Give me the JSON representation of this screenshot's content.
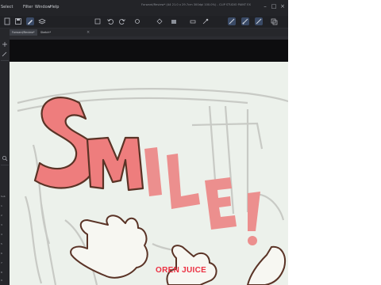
{
  "app": {
    "title": "Forward/Review* (A4 21.0 x 29.7cm 300dpi 100.0%) - CLIP STUDIO PAINT EX",
    "accent_color": "#3a4a66"
  },
  "menubar": {
    "items": [
      "Select",
      "Filter",
      "Window",
      "Help"
    ],
    "window_controls": [
      "minimize-icon",
      "maximize-icon",
      "close-icon"
    ]
  },
  "toolbar": {
    "icons": [
      "new-file-icon",
      "save-icon",
      "undo-icon",
      "redo-icon",
      "transform-icon",
      "fill-icon",
      "select-icon",
      "pen-icon",
      "eraser-icon",
      "brush-icon",
      "layer-icon",
      "settings-icon",
      "ruler-icon",
      "snap-icon",
      "grid-icon"
    ]
  },
  "tabs": {
    "items": [
      "Forward/Review*",
      "Sketch*"
    ]
  },
  "toolstrip": {
    "labels": [
      "Sub",
      "1",
      "2",
      "3",
      "4",
      "5",
      "6",
      "7",
      "8",
      "9"
    ],
    "icons": [
      "search-icon",
      "move-icon",
      "brush-icon"
    ]
  },
  "canvas": {
    "background": "#ecf1eb",
    "artwork_text": "SMILE!",
    "credit": "OREN JUICE",
    "credit_color": "#ec2f41",
    "letter_fill_color": "#ee7d7d",
    "outline_color": "#5a3326"
  }
}
